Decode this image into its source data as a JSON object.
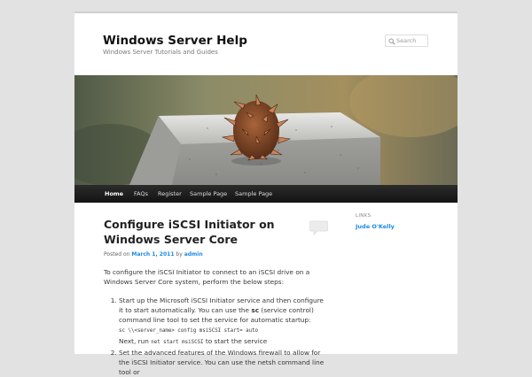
{
  "site": {
    "title": "Windows Server Help",
    "description": "Windows Server Tutorials and Guides"
  },
  "search": {
    "placeholder": "Search"
  },
  "nav": {
    "items": [
      {
        "label": "Home",
        "active": true
      },
      {
        "label": "FAQs"
      },
      {
        "label": "Register"
      },
      {
        "label": "Sample Page"
      },
      {
        "label": "Sample Page"
      }
    ]
  },
  "post": {
    "title": "Configure iSCSI Initiator on Windows Server Core",
    "meta": {
      "posted_on": "Posted on",
      "date": "March 1, 2011",
      "by": "by",
      "author": "admin"
    },
    "intro": "To configure the iSCSI Initiator to connect to an iSCSI drive on a Windows Server Core system,  perform the below steps:",
    "steps": [
      {
        "text_a": "Start up the Microsoft iSCSI Initiator service and then configure it to start automatically. You can use the ",
        "strong": "sc",
        "text_b": " (service control) command line tool to set the service for automatic startup:",
        "code1": "sc \\\\<server_name> config msiSCSI start= auto",
        "next_a": "Next, run ",
        "code2": "net start msiSCSI",
        "next_b": " to start the service"
      },
      {
        "text": "Set the advanced features of  the Windows firewall to allow for the iSCSI Initiator service. You can use the netsh command line tool or"
      }
    ]
  },
  "sidebar": {
    "heading": "LINKS",
    "links": [
      {
        "label": "Jude O'Kelly"
      }
    ]
  },
  "colors": {
    "link": "#1b8be0",
    "nav_bg": "#222222",
    "page_bg": "#e2e2e2"
  },
  "icons": {
    "search": "search-icon",
    "comment": "comment-bubble-icon"
  }
}
